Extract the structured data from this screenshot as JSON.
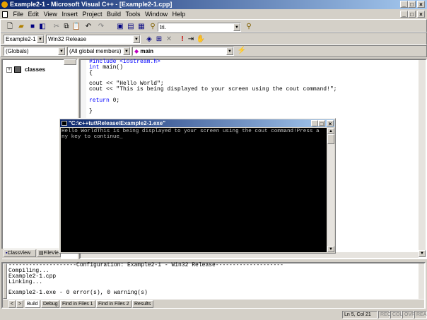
{
  "window": {
    "title": "Example2-1 - Microsoft Visual C++ - [Example2-1.cpp]",
    "min_glyph": "_",
    "max_glyph": "□",
    "close_glyph": "×"
  },
  "menu": {
    "items": [
      "File",
      "Edit",
      "View",
      "Insert",
      "Project",
      "Build",
      "Tools",
      "Window",
      "Help"
    ]
  },
  "toolbar": {
    "find_value": "tri.",
    "project_value": "Example2-1",
    "config_value": "Win32 Release"
  },
  "wizardbar": {
    "scope_value": "(Globals)",
    "members_value": "(All global members)",
    "function_value": "main"
  },
  "workspace": {
    "tree_root": "classes",
    "tab_classview": "ClassView",
    "tab_fileview": "FileVie"
  },
  "editor": {
    "line1": "#include <iostream.h>",
    "line2_kw": "int",
    "line2_rest": " main()",
    "line3": "{",
    "line4": "cout << \"Hello World\";",
    "line5": "cout << \"This is being displayed to your screen using the cout command!\";",
    "line6_kw": "return",
    "line6_rest": " 0;",
    "line7": "}"
  },
  "console": {
    "title": "\"C:\\c++tut\\Release\\Example2-1.exe\"",
    "line1": "Hello WorldThis is being displayed to your screen using the cout command!Press a",
    "line2": "ny key to continue",
    "cursor": "_"
  },
  "output": {
    "line1": "--------------------Configuration: Example2-1 - Win32 Release--------------------",
    "line2": "Compiling...",
    "line3": "Example2-1.cpp",
    "line4": "Linking...",
    "line5": "",
    "line6": "Example2-1.exe - 0 error(s), 0 warning(s)",
    "tabs": [
      "Build",
      "Debug",
      "Find in Files 1",
      "Find in Files 2",
      "Results"
    ]
  },
  "statusbar": {
    "position": "Ln 5, Col 21",
    "rec": "REC",
    "col": "COL",
    "ovr": "OVR",
    "read": "READ"
  }
}
